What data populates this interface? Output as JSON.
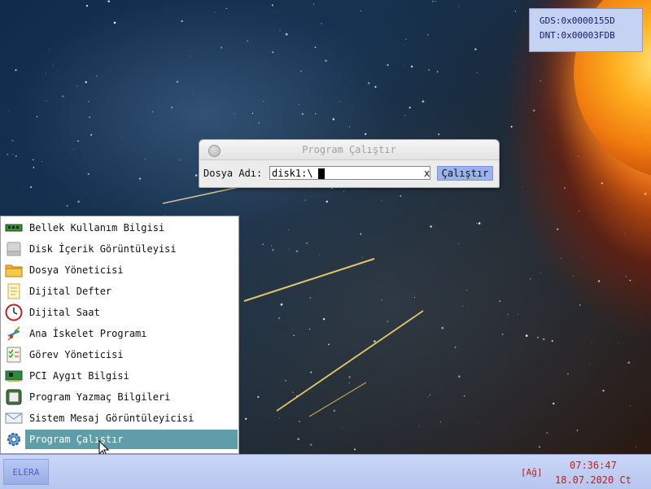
{
  "system_info": {
    "gds": "GDS:0x0000155D",
    "dnt": "DNT:0x00003FDB"
  },
  "run_dialog": {
    "title": "Program Çalıştır",
    "label": "Dosya Adı:",
    "input_value": "disk1:\\",
    "clear_label": "x",
    "run_label": "Çalıştır"
  },
  "start_menu": {
    "items": [
      {
        "label": "Bellek Kullanım Bilgisi",
        "icon": "memory-icon"
      },
      {
        "label": "Disk İçerik Görüntüleyisi",
        "icon": "disk-icon"
      },
      {
        "label": "Dosya Yöneticisi",
        "icon": "folder-icon"
      },
      {
        "label": "Dijital Defter",
        "icon": "notepad-icon"
      },
      {
        "label": "Dijital Saat",
        "icon": "clock-icon"
      },
      {
        "label": "Ana İskelet Programı",
        "icon": "dna-icon"
      },
      {
        "label": "Görev Yöneticisi",
        "icon": "task-list-icon"
      },
      {
        "label": "PCI Aygıt Bilgisi",
        "icon": "pci-card-icon"
      },
      {
        "label": "Program Yazmaç Bilgileri",
        "icon": "chip-icon"
      },
      {
        "label": "Sistem Mesaj Görüntüleyicisi",
        "icon": "envelope-icon"
      },
      {
        "label": "Program Çalıştır",
        "icon": "gear-icon",
        "selected": true
      }
    ]
  },
  "taskbar": {
    "start_label": "ELERA",
    "network_status": "[Ağ]",
    "time": "07:36:47",
    "date": "18.07.2020 Ct"
  },
  "colors": {
    "menu_highlight": "#5f9ea9",
    "taskbar": "#c9d6f7",
    "clock_text": "#c81818",
    "run_button": "#9ab3ef",
    "sysinfo_bg": "#c6d2f4"
  }
}
